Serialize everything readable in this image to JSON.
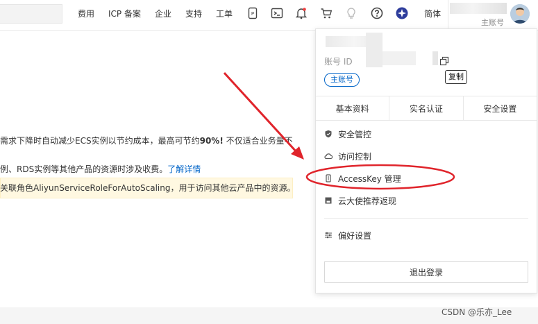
{
  "topbar": {
    "links": [
      "费用",
      "ICP 备案",
      "企业",
      "支持",
      "工单"
    ],
    "language": "简体",
    "user_role": "主账号"
  },
  "content": {
    "line1_prefix": "需求下降时自动减少ECS实例以节约成本，最高可节约",
    "line1_bold": "90%!",
    "line1_suffix": " 不仅适合业务量不",
    "line2_text": "例、RDS实例等其他产品的资源时涉及收费。",
    "line2_link": "了解详情",
    "notice_text": "关联角色AliyunServiceRoleForAutoScaling，用于访问其他云产品中的资源。"
  },
  "dropdown": {
    "account_id_label": "账号 ID",
    "copy_tooltip": "复制",
    "tag": "主账号",
    "tabs": [
      "基本资料",
      "实名认证",
      "安全设置"
    ],
    "menu": [
      {
        "label": "安全管控",
        "icon": "shield-icon"
      },
      {
        "label": "访问控制",
        "icon": "cloud-icon"
      },
      {
        "label": "AccessKey 管理",
        "icon": "key-icon"
      },
      {
        "label": "云大使推荐返现",
        "icon": "gift-icon"
      },
      {
        "label": "偏好设置",
        "icon": "sliders-icon"
      }
    ],
    "logout": "退出登录"
  },
  "watermark": "CSDN @乐亦_Lee",
  "colors": {
    "accent": "#0064c8",
    "annotation": "#e0242b",
    "notice_bg": "#fff8e1"
  }
}
